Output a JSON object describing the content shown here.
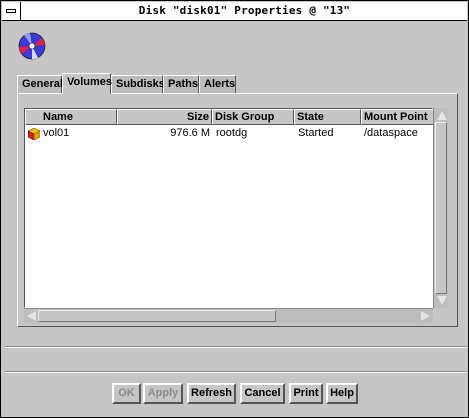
{
  "window": {
    "title": "Disk \"disk01\" Properties @ \"13\""
  },
  "header": {
    "icon": "disk-icon"
  },
  "tabs": [
    {
      "label": "General"
    },
    {
      "label": "Volumes",
      "active": true
    },
    {
      "label": "Subdisks"
    },
    {
      "label": "Paths"
    },
    {
      "label": "Alerts"
    }
  ],
  "table": {
    "columns": [
      "Name",
      "Size",
      "Disk Group",
      "State",
      "Mount Point"
    ],
    "rows": [
      {
        "icon": "volume-icon",
        "name": "vol01",
        "size": "976.6 M",
        "disk_group": "rootdg",
        "state": "Started",
        "mount_point": "/dataspace"
      }
    ]
  },
  "buttons": {
    "ok": "OK",
    "apply": "Apply",
    "refresh": "Refresh",
    "cancel": "Cancel",
    "print": "Print",
    "help": "Help"
  },
  "colors": {
    "background": "#c6c6c6",
    "disabled_text": "#8a8a8a",
    "disk_icon_blue": "#3a3ad8",
    "disk_icon_red": "#e0204a",
    "volume_icon_yellow": "#f0c020",
    "volume_icon_red": "#d02020"
  }
}
